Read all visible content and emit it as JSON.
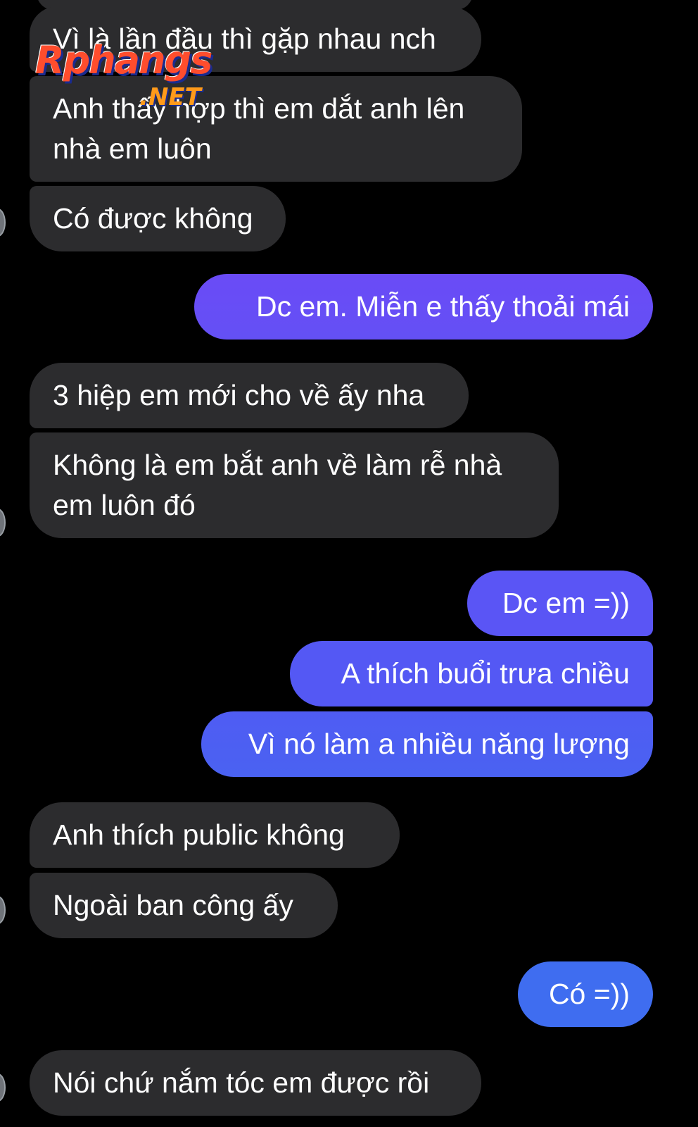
{
  "watermark": {
    "brand": "Rphangs",
    "suffix": ".NET"
  },
  "messages": [
    {
      "id": 1,
      "sender": "other",
      "lines": [
        "Vì là lần đầu thì gặp nhau nch"
      ]
    },
    {
      "id": 2,
      "sender": "other",
      "lines": [
        "Anh thấy hợp thì em dắt anh lên",
        "nhà em luôn"
      ]
    },
    {
      "id": 3,
      "sender": "other",
      "lines": [
        "Có được không"
      ]
    },
    {
      "id": 4,
      "sender": "me",
      "lines": [
        "Dc em. Miễn e thấy thoải mái"
      ]
    },
    {
      "id": 5,
      "sender": "other",
      "lines": [
        "3 hiệp em mới cho về ấy nha"
      ]
    },
    {
      "id": 6,
      "sender": "other",
      "lines": [
        "Không là em bắt anh về làm rễ nhà",
        "em luôn đó"
      ]
    },
    {
      "id": 7,
      "sender": "me",
      "lines": [
        "Dc em =))"
      ]
    },
    {
      "id": 8,
      "sender": "me",
      "lines": [
        "A thích buổi trưa chiều"
      ]
    },
    {
      "id": 9,
      "sender": "me",
      "lines": [
        "Vì nó làm a nhiều năng lượng"
      ]
    },
    {
      "id": 10,
      "sender": "other",
      "lines": [
        "Anh thích public không"
      ]
    },
    {
      "id": 11,
      "sender": "other",
      "lines": [
        "Ngoài ban công ấy"
      ]
    },
    {
      "id": 12,
      "sender": "me",
      "lines": [
        "Có =))"
      ]
    },
    {
      "id": 13,
      "sender": "other",
      "lines": [
        "Nói chứ nắm tóc em được rồi"
      ]
    }
  ],
  "colors": {
    "background": "#000000",
    "incoming_bubble": "#2c2c2e",
    "outgoing_gradient_top": "#6a4bf6",
    "outgoing_gradient_bottom": "#3f6df0",
    "text": "#ffffff"
  }
}
